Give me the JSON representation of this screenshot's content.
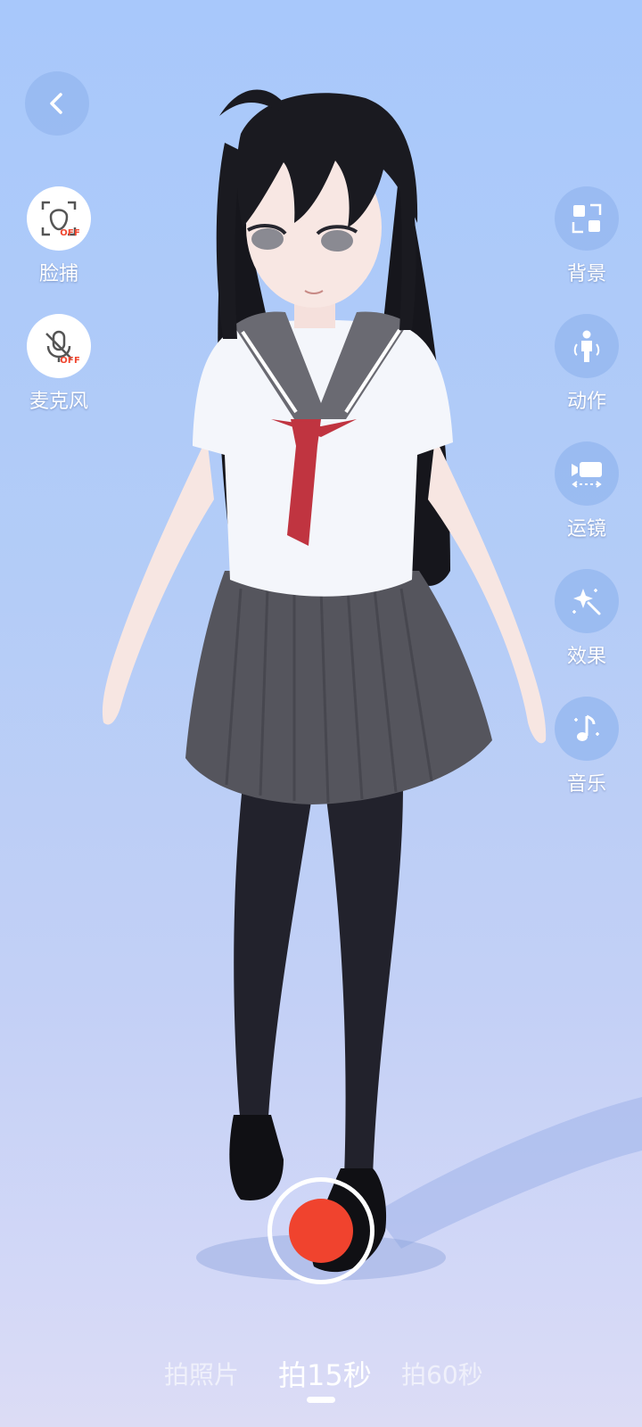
{
  "left_tools": [
    {
      "label": "脸捕",
      "badge": "OFF",
      "icon": "face-capture-icon"
    },
    {
      "label": "麦克风",
      "badge": "OFF",
      "icon": "mic-off-icon"
    }
  ],
  "right_tools": [
    {
      "label": "背景",
      "icon": "background-icon"
    },
    {
      "label": "动作",
      "icon": "person-action-icon"
    },
    {
      "label": "运镜",
      "icon": "camera-move-icon"
    },
    {
      "label": "效果",
      "icon": "sparkle-effect-icon"
    },
    {
      "label": "音乐",
      "icon": "music-note-icon"
    }
  ],
  "modes": [
    "拍照片",
    "拍15秒",
    "拍60秒"
  ],
  "active_mode": "拍15秒",
  "colors": {
    "record": "#f0432e",
    "off_badge": "#f0462f",
    "button_bg": "#96b8f0"
  }
}
